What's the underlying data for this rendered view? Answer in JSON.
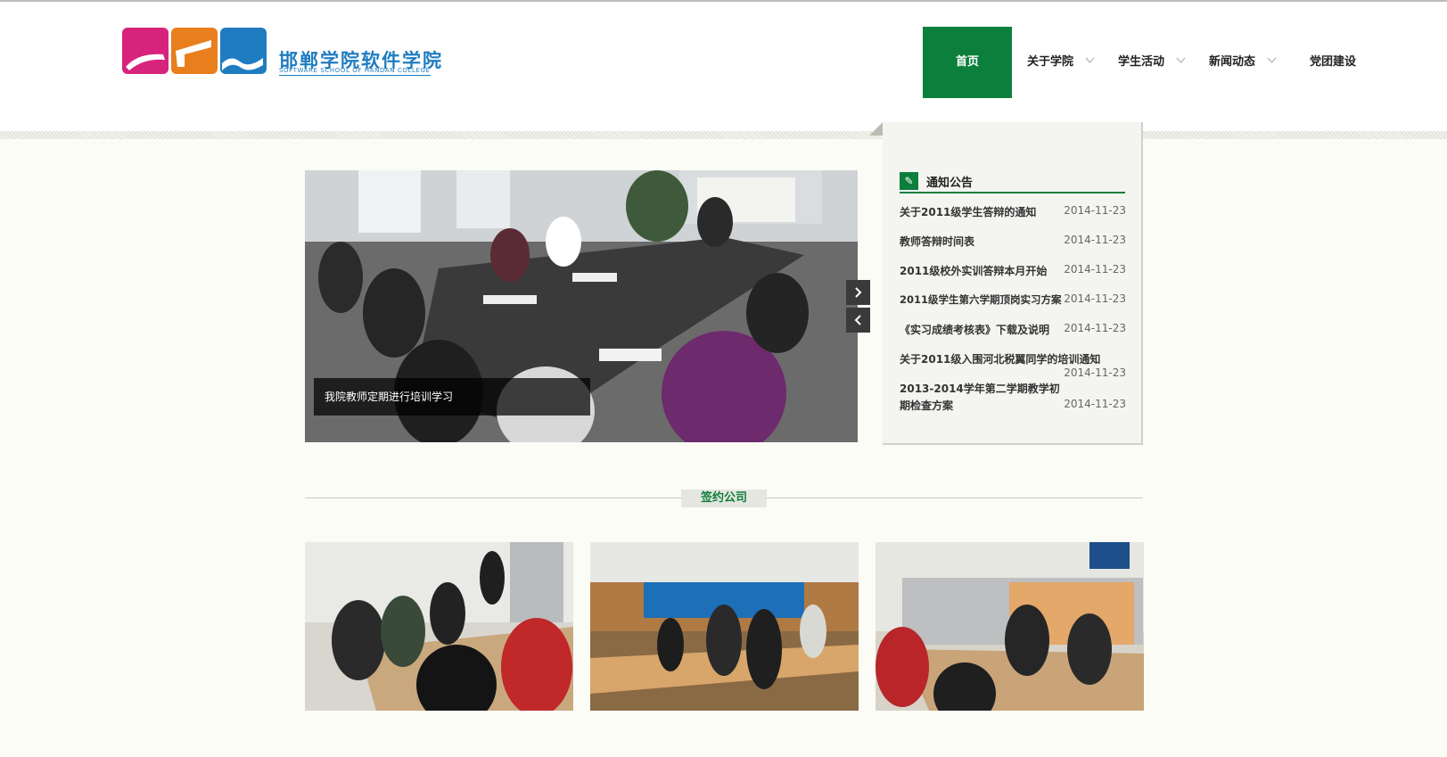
{
  "header": {
    "logo_cn": "邯郸学院软件学院",
    "logo_en": "SOFTWARE SCHOOL OF HANDAN COLLEGE"
  },
  "nav": [
    {
      "label": "首页",
      "active": true
    },
    {
      "label": "关于学院",
      "has_dropdown": true
    },
    {
      "label": "学生活动",
      "has_dropdown": true
    },
    {
      "label": "新闻动态",
      "has_dropdown": true
    },
    {
      "label": "党团建设",
      "has_dropdown": false
    }
  ],
  "slider": {
    "caption": "我院教师定期进行培训学习",
    "next_icon": "chevron-right-icon",
    "prev_icon": "chevron-left-icon"
  },
  "notices": {
    "title": "通知公告",
    "icon": "pencil-icon",
    "items": [
      {
        "text": "关于2011级学生答辩的通知",
        "date": "2014-11-23"
      },
      {
        "text": "教师答辩时间表",
        "date": "2014-11-23"
      },
      {
        "text": "2011级校外实训答辩本月开始",
        "date": "2014-11-23"
      },
      {
        "text": "2011级学生第六学期顶岗实习方案",
        "date": "2014-11-23"
      },
      {
        "text": "《实习成绩考核表》下载及说明",
        "date": "2014-11-23"
      },
      {
        "text": "关于2011级入围河北税翼同学的培训通知",
        "date": "2014-11-23"
      },
      {
        "text": "2013-2014学年第二学期教学初期检查方案",
        "date": "2014-11-23"
      }
    ]
  },
  "companies": {
    "title": "签约公司"
  },
  "colors": {
    "brand_green": "#0d7f3c",
    "logo_blue": "#1f7cc0",
    "logo_magenta": "#d8237d",
    "logo_orange": "#e87e1c",
    "background": "#fcfcf6"
  }
}
